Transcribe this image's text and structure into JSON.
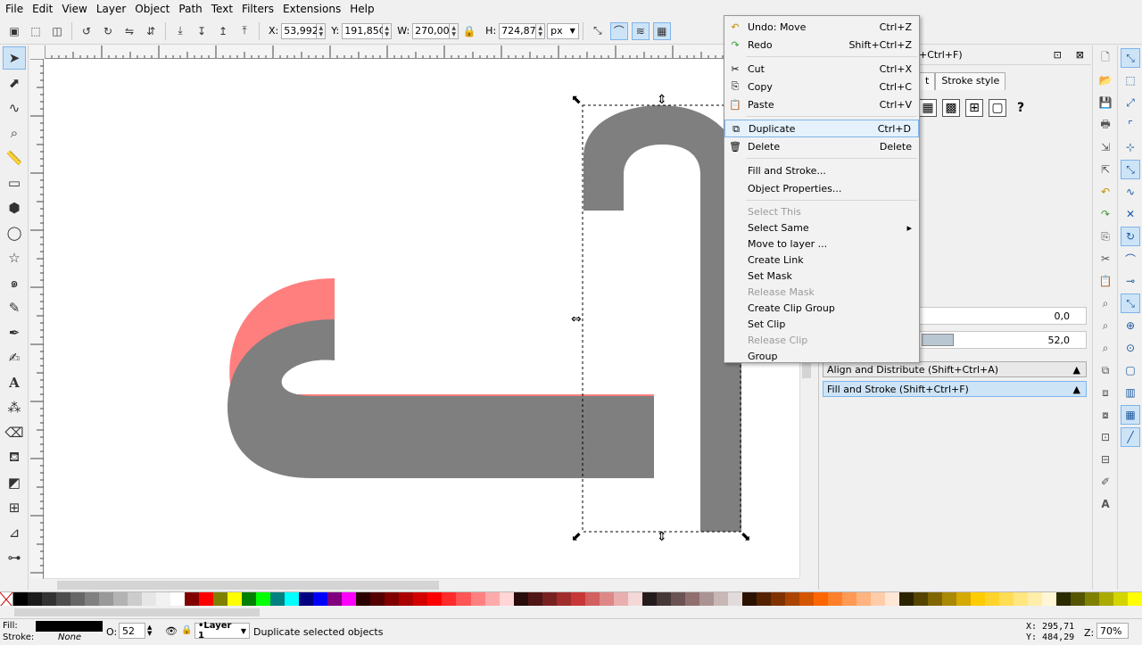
{
  "menubar": {
    "items": [
      "File",
      "Edit",
      "View",
      "Layer",
      "Object",
      "Path",
      "Text",
      "Filters",
      "Extensions",
      "Help"
    ]
  },
  "toolctrl": {
    "x_label": "X:",
    "x_value": "53,992",
    "y_label": "Y:",
    "y_value": "191,85C",
    "w_label": "W:",
    "w_value": "270,00C",
    "h_label": "H:",
    "h_value": "724,873",
    "unit": "px"
  },
  "canvas": {
    "colors": {
      "pink": "#ff7f7f",
      "gray": "#7f7f7f"
    }
  },
  "dock": {
    "title": "+Ctrl+F)",
    "tabs": [
      "t",
      "Stroke style"
    ],
    "blur_value": "0,0",
    "opacity_value": "52,0",
    "panels": [
      "Align and Distribute (Shift+Ctrl+A)",
      "Fill and Stroke (Shift+Ctrl+F)"
    ]
  },
  "context_menu": {
    "items": [
      {
        "label": "Undo: Move",
        "accel": "Ctrl+Z",
        "icon": "undo-icon",
        "disabled": false
      },
      {
        "label": "Redo",
        "accel": "Shift+Ctrl+Z",
        "icon": "redo-icon",
        "disabled": false
      },
      {
        "sep": true
      },
      {
        "label": "Cut",
        "accel": "Ctrl+X",
        "icon": "cut-icon",
        "disabled": false
      },
      {
        "label": "Copy",
        "accel": "Ctrl+C",
        "icon": "copy-icon",
        "disabled": false
      },
      {
        "label": "Paste",
        "accel": "Ctrl+V",
        "icon": "paste-icon",
        "disabled": false
      },
      {
        "sep": true
      },
      {
        "label": "Duplicate",
        "accel": "Ctrl+D",
        "icon": "duplicate-icon",
        "disabled": false,
        "highlight": true
      },
      {
        "label": "Delete",
        "accel": "Delete",
        "icon": "delete-icon",
        "disabled": false
      },
      {
        "sep": true
      },
      {
        "label": "Fill and Stroke...",
        "accel": "",
        "disabled": false
      },
      {
        "label": "Object Properties...",
        "accel": "",
        "disabled": false
      },
      {
        "sep": true
      },
      {
        "label": "Select This",
        "accel": "",
        "disabled": true
      },
      {
        "label": "Select Same",
        "accel": "",
        "disabled": false,
        "submenu": true
      },
      {
        "label": "Move to layer ...",
        "accel": "",
        "disabled": false
      },
      {
        "label": "Create Link",
        "accel": "",
        "disabled": false
      },
      {
        "label": "Set Mask",
        "accel": "",
        "disabled": false
      },
      {
        "label": "Release Mask",
        "accel": "",
        "disabled": true
      },
      {
        "label": "Create Clip Group",
        "accel": "",
        "disabled": false
      },
      {
        "label": "Set Clip",
        "accel": "",
        "disabled": false
      },
      {
        "label": "Release Clip",
        "accel": "",
        "disabled": true
      },
      {
        "label": "Group",
        "accel": "",
        "disabled": false
      }
    ]
  },
  "statusbar": {
    "fill_label": "Fill:",
    "stroke_label": "Stroke:",
    "stroke_value": "None",
    "opacity_label": "O:",
    "opacity_value": "52",
    "layer": "•Layer 1",
    "message": "Duplicate selected objects",
    "x_coord": "X:  295,71",
    "y_coord": "Y:  484,29",
    "zoom_label": "Z:",
    "zoom_value": "70%"
  },
  "palette": {
    "colors": [
      "#000000",
      "#1a1a1a",
      "#333333",
      "#4d4d4d",
      "#666666",
      "#808080",
      "#999999",
      "#b3b3b3",
      "#cccccc",
      "#e6e6e6",
      "#f2f2f2",
      "#ffffff",
      "#800000",
      "#ff0000",
      "#808000",
      "#ffff00",
      "#008000",
      "#00ff00",
      "#008080",
      "#00ffff",
      "#000080",
      "#0000ff",
      "#800080",
      "#ff00ff",
      "#2b0000",
      "#550000",
      "#800000",
      "#aa0000",
      "#d40000",
      "#ff0000",
      "#ff2a2a",
      "#ff5555",
      "#ff8080",
      "#ffaaaa",
      "#ffd5d5",
      "#280b0b",
      "#501616",
      "#782121",
      "#a02c2c",
      "#c83737",
      "#d35f5f",
      "#de8787",
      "#e9afaf",
      "#f4d7d7",
      "#241c1c",
      "#483737",
      "#6c5353",
      "#916f6f",
      "#ac9393",
      "#c8b7b7",
      "#e3dbdb",
      "#2b1100",
      "#552200",
      "#803300",
      "#aa4400",
      "#d45500",
      "#ff6600",
      "#ff7f2a",
      "#ff9955",
      "#ffb380",
      "#ffccaa",
      "#ffe6d5",
      "#2b2200",
      "#554400",
      "#806600",
      "#aa8800",
      "#d4aa00",
      "#ffcc00",
      "#ffd42a",
      "#ffdd55",
      "#ffe680",
      "#ffeeaa",
      "#fff6d5",
      "#2b2b00",
      "#555500",
      "#808000",
      "#aaaa00",
      "#d4d400",
      "#ffff00"
    ]
  }
}
